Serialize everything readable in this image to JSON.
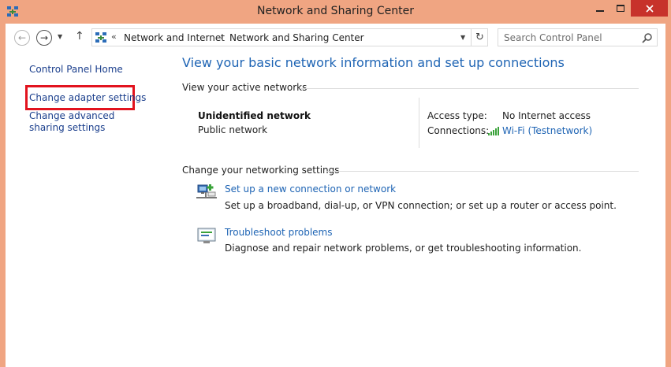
{
  "window": {
    "title": "Network and Sharing Center"
  },
  "nav": {
    "breadcrumb_overflow": "«",
    "crumbs": [
      "Network and Internet",
      "Network and Sharing Center"
    ],
    "search_placeholder": "Search Control Panel"
  },
  "sidebar": {
    "items": [
      {
        "label": "Control Panel Home"
      },
      {
        "label": "Change adapter settings"
      },
      {
        "label": "Change advanced sharing settings"
      }
    ]
  },
  "main": {
    "title": "View your basic network information and set up connections",
    "active_networks": {
      "heading": "View your active networks",
      "network_name": "Unidentified network",
      "network_type": "Public network",
      "access_type_label": "Access type:",
      "access_type_value": "No Internet access",
      "connections_label": "Connections:",
      "connection_value": "Wi-Fi (Testnetwork)"
    },
    "settings": {
      "heading": "Change your networking settings",
      "tasks": [
        {
          "link": "Set up a new connection or network",
          "desc": "Set up a broadband, dial-up, or VPN connection; or set up a router or access point.",
          "icon": "network-setup-icon"
        },
        {
          "link": "Troubleshoot problems",
          "desc": "Diagnose and repair network problems, or get troubleshooting information.",
          "icon": "troubleshoot-icon"
        }
      ]
    }
  },
  "colors": {
    "window_frame": "#f0a582",
    "link": "#1e64b4",
    "highlight_box": "#e2131e",
    "close_button": "#c7322b"
  }
}
